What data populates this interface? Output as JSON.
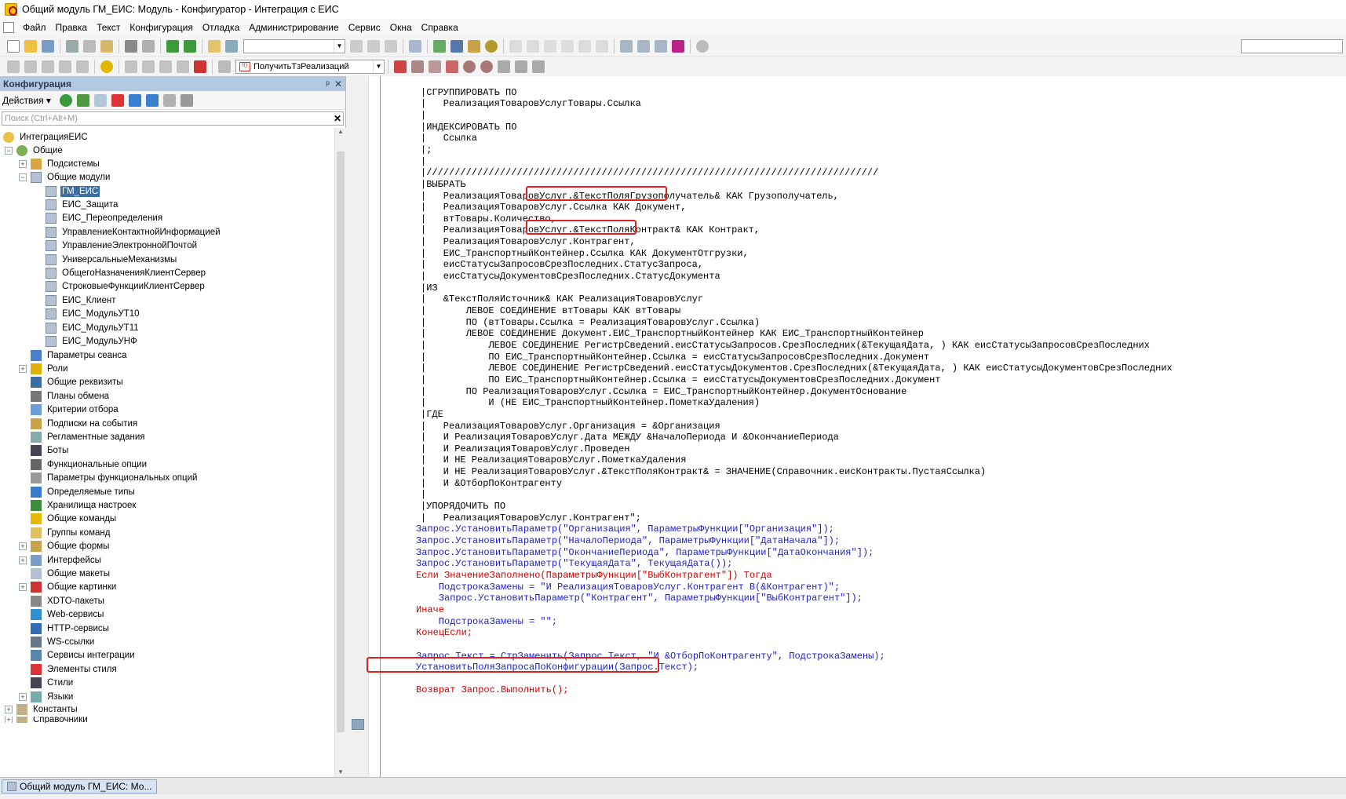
{
  "window": {
    "title": "Общий модуль ГМ_ЕИС: Модуль - Конфигуратор - Интеграция с ЕИС"
  },
  "menu": [
    "Файл",
    "Правка",
    "Текст",
    "Конфигурация",
    "Отладка",
    "Администрирование",
    "Сервис",
    "Окна",
    "Справка"
  ],
  "toolbar2": {
    "procedure_combo": "ПолучитьТзРеализаций"
  },
  "panel": {
    "title": "Конфигурация",
    "actions_label": "Действия",
    "search_placeholder": "Поиск (Ctrl+Alt+M)"
  },
  "tree": {
    "root": "ИнтеграцияЕИС",
    "common": "Общие",
    "subsystems": "Подсистемы",
    "common_modules": "Общие модули",
    "modules": [
      "ГМ_ЕИС",
      "ЕИС_Защита",
      "ЕИС_Переопределения",
      "УправлениеКонтактнойИнформацией",
      "УправлениеЭлектроннойПочтой",
      "УниверсальныеМеханизмы",
      "ОбщегоНазначенияКлиентСервер",
      "СтроковыеФункцииКлиентСервер",
      "ЕИС_Клиент",
      "ЕИС_МодульУТ10",
      "ЕИС_МодульУТ11",
      "ЕИС_МодульУНФ"
    ],
    "others": [
      "Параметры сеанса",
      "Роли",
      "Общие реквизиты",
      "Планы обмена",
      "Критерии отбора",
      "Подписки на события",
      "Регламентные задания",
      "Боты",
      "Функциональные опции",
      "Параметры функциональных опций",
      "Определяемые типы",
      "Хранилища настроек",
      "Общие команды",
      "Группы команд",
      "Общие формы",
      "Интерфейсы",
      "Общие макеты",
      "Общие картинки",
      "XDTO-пакеты",
      "Web-сервисы",
      "HTTP-сервисы",
      "WS-ссылки",
      "Сервисы интеграции",
      "Элементы стиля",
      "Стили",
      "Языки"
    ],
    "constants": "Константы",
    "cut": "Справочники"
  },
  "code": {
    "lines": [
      "",
      "|СГРУППИРОВАТЬ ПО",
      "|   РеализацияТоваровУслугТовары.Ссылка",
      "|",
      "|ИНДЕКСИРОВАТЬ ПО",
      "|   Ссылка",
      "|;",
      "|",
      "|////////////////////////////////////////////////////////////////////////////////",
      "|ВЫБРАТЬ",
      "|   РеализацияТоваровУслуг.&ТекстПоляГрузополучатель& КАК Грузополучатель,",
      "|   РеализацияТоваровУслуг.Ссылка КАК Документ,",
      "|   втТовары.Количество,",
      "|   РеализацияТоваровУслуг.&ТекстПоляКонтракт& КАК Контракт,",
      "|   РеализацияТоваровУслуг.Контрагент,",
      "|   ЕИС_ТранспортныйКонтейнер.Ссылка КАК ДокументОтгрузки,",
      "|   еисСтатусыЗапросовСрезПоследних.СтатусЗапроса,",
      "|   еисСтатусыДокументовСрезПоследних.СтатусДокумента",
      "|ИЗ",
      "|   &ТекстПоляИсточник& КАК РеализацияТоваровУслуг",
      "|       ЛЕВОЕ СОЕДИНЕНИЕ втТовары КАК втТовары",
      "|       ПО (втТовары.Ссылка = РеализацияТоваровУслуг.Ссылка)",
      "|       ЛЕВОЕ СОЕДИНЕНИЕ Документ.ЕИС_ТранспортныйКонтейнер КАК ЕИС_ТранспортныйКонтейнер",
      "|           ЛЕВОЕ СОЕДИНЕНИЕ РегистрСведений.еисСтатусыЗапросов.СрезПоследних(&ТекущаяДата, ) КАК еисСтатусыЗапросовСрезПоследних",
      "|           ПО ЕИС_ТранспортныйКонтейнер.Ссылка = еисСтатусыЗапросовСрезПоследних.Документ",
      "|           ЛЕВОЕ СОЕДИНЕНИЕ РегистрСведений.еисСтатусыДокументов.СрезПоследних(&ТекущаяДата, ) КАК еисСтатусыДокументовСрезПоследних",
      "|           ПО ЕИС_ТранспортныйКонтейнер.Ссылка = еисСтатусыДокументовСрезПоследних.Документ",
      "|       ПО РеализацияТоваровУслуг.Ссылка = ЕИС_ТранспортныйКонтейнер.ДокументОснование",
      "|           И (НЕ ЕИС_ТранспортныйКонтейнер.ПометкаУдаления)",
      "|ГДЕ",
      "|   РеализацияТоваровУслуг.Организация = &Организация",
      "|   И РеализацияТоваровУслуг.Дата МЕЖДУ &НачалоПериода И &ОкончаниеПериода",
      "|   И РеализацияТоваровУслуг.Проведен",
      "|   И НЕ РеализацияТоваровУслуг.ПометкаУдаления",
      "|   И НЕ РеализацияТоваровУслуг.&ТекстПоляКонтракт& = ЗНАЧЕНИЕ(Справочник.еисКонтракты.ПустаяСсылка)",
      "|   И &ОтборПоКонтрагенту",
      "|",
      "|УПОРЯДОЧИТЬ ПО",
      "|   РеализацияТоваровУслуг.Контрагент\";",
      "Запрос.УстановитьПараметр(\"Организация\", ПараметрыФункции[\"Организация\"]);",
      "Запрос.УстановитьПараметр(\"НачалоПериода\", ПараметрыФункции[\"ДатаНачала\"]);",
      "Запрос.УстановитьПараметр(\"ОкончаниеПериода\", ПараметрыФункции[\"ДатаОкончания\"]);",
      "Запрос.УстановитьПараметр(\"ТекущаяДата\", ТекущаяДата());",
      "Если ЗначениеЗаполнено(ПараметрыФункции[\"ВыбКонтрагент\"]) Тогда",
      "    ПодстрокаЗамены = \"И РеализацияТоваровУслуг.Контрагент В(&Контрагент)\";",
      "    Запрос.УстановитьПараметр(\"Контрагент\", ПараметрыФункции[\"ВыбКонтрагент\"]);",
      "Иначе",
      "    ПодстрокаЗамены = \"\";",
      "КонецЕсли;",
      "",
      "Запрос.Текст = СтрЗаменить(Запрос.Текст, \"И &ОтборПоКонтрагенту\", ПодстрокаЗамены);",
      "УстановитьПоляЗапросаПоКонфигурации(Запрос.Текст);",
      "",
      "Возврат Запрос.Выполнить();"
    ]
  },
  "taskbar": {
    "item": "Общий модуль ГМ_ЕИС: Мо..."
  }
}
